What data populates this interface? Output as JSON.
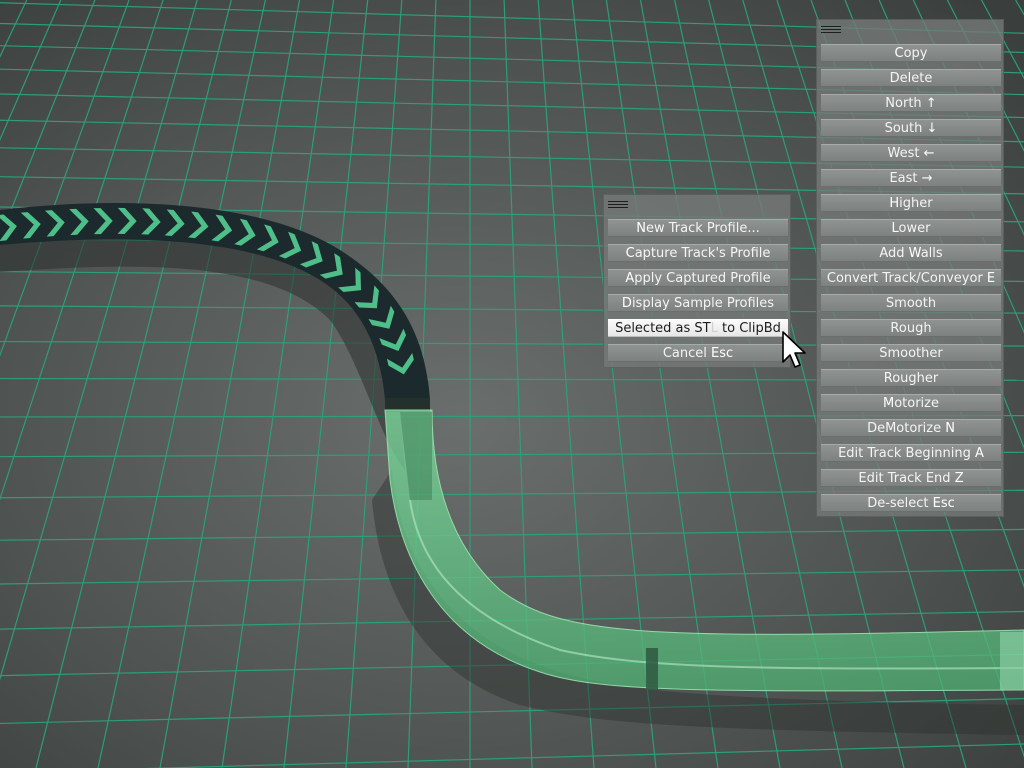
{
  "scene": {
    "ground_color": "#4a4e4c",
    "grid_color": "#2aa37a",
    "track_dark_color": "#1c2a2e",
    "chevron_color": "#4fbf8a",
    "track_selected_color": "#6fd08f"
  },
  "context_menu": {
    "handle_icon": "drag-handle-icon",
    "items": [
      {
        "pre": "",
        "key": "N",
        "post": "ew Track Profile..."
      },
      {
        "pre": "",
        "key": "C",
        "post": "apture Track's Profile"
      },
      {
        "pre": "",
        "key": "A",
        "post": "pply Captured Profile"
      },
      {
        "pre": "",
        "key": "D",
        "post": "isplay Sample Profiles"
      },
      {
        "pre": "Selected as ST",
        "key": "L",
        "post": " to ClipBd"
      },
      {
        "pre": "Cancel ",
        "key": "Esc",
        "post": ""
      }
    ],
    "hovered_index": 4
  },
  "edit_menu": {
    "handle_icon": "drag-handle-icon",
    "items": [
      {
        "pre": "",
        "key": "C",
        "post": "opy"
      },
      {
        "pre": "De",
        "key": "l",
        "post": "ete"
      },
      {
        "pre": "North ",
        "key": "↑",
        "post": ""
      },
      {
        "pre": "South ",
        "key": "↓",
        "post": ""
      },
      {
        "pre": "West ",
        "key": "←",
        "post": ""
      },
      {
        "pre": "East ",
        "key": "→",
        "post": ""
      },
      {
        "pre": "",
        "key": "H",
        "post": "igher"
      },
      {
        "pre": "",
        "key": "L",
        "post": "ower"
      },
      {
        "pre": "Add ",
        "key": "W",
        "post": "alls"
      },
      {
        "pre": "Convert Track/Conveyor ",
        "key": "E",
        "post": ""
      },
      {
        "pre": "Smooth",
        "key": "",
        "post": ""
      },
      {
        "pre": "Rough",
        "key": "",
        "post": ""
      },
      {
        "pre": "Smoother",
        "key": "",
        "post": ""
      },
      {
        "pre": "Rougher",
        "key": "",
        "post": ""
      },
      {
        "pre": "",
        "key": "M",
        "post": "otorize"
      },
      {
        "pre": "DeMotorize ",
        "key": "N",
        "post": ""
      },
      {
        "pre": "Edit Track Beginning ",
        "key": "A",
        "post": ""
      },
      {
        "pre": "Edit Track End ",
        "key": "Z",
        "post": ""
      },
      {
        "pre": "De-select ",
        "key": "Esc",
        "post": ""
      }
    ]
  },
  "cursor_icon": "arrow-cursor-icon"
}
